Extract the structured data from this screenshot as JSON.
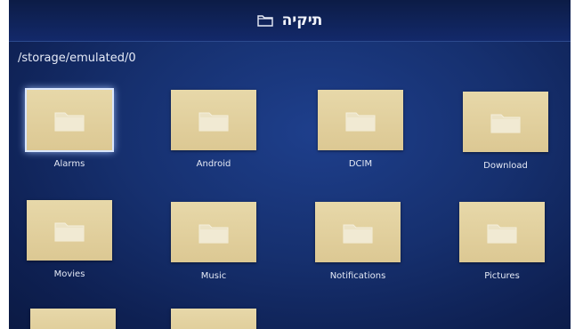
{
  "header": {
    "title": "תיקיה",
    "icon": "folder-outline-icon"
  },
  "path": "/storage/emulated/0",
  "folders": [
    {
      "label": "Alarms",
      "icon": "folder-icon",
      "selected": true
    },
    {
      "label": "Android",
      "icon": "folder-icon"
    },
    {
      "label": "DCIM",
      "icon": "folder-icon"
    },
    {
      "label": "Download",
      "icon": "folder-icon"
    },
    {
      "label": "Movies",
      "icon": "folder-icon"
    },
    {
      "label": "Music",
      "icon": "folder-icon"
    },
    {
      "label": "Notifications",
      "icon": "folder-icon"
    },
    {
      "label": "Pictures",
      "icon": "folder-icon"
    }
  ],
  "colors": {
    "background": "#16306f",
    "folder_tile": "#e3d3a2",
    "selection": "#d9e6ff"
  }
}
